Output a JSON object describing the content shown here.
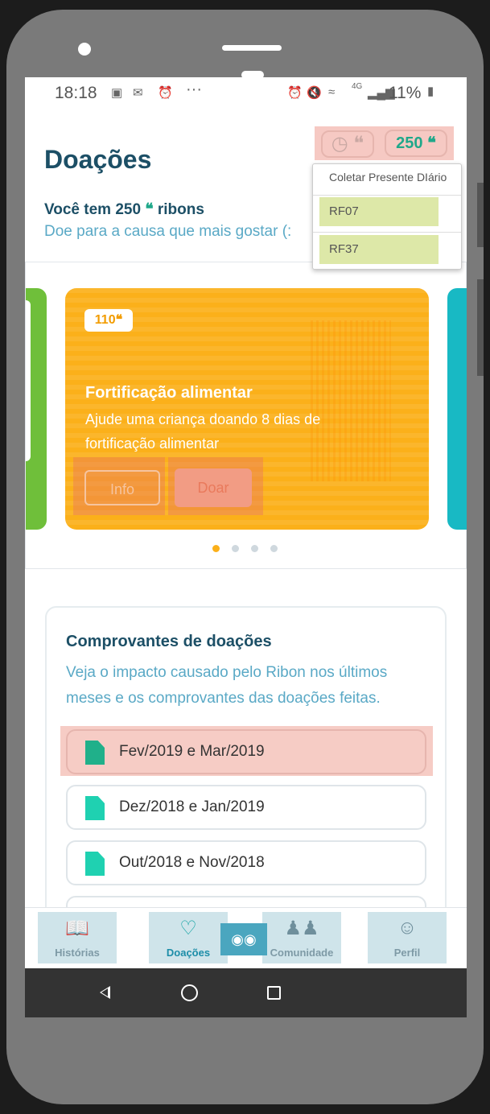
{
  "status_bar": {
    "time": "18:18",
    "dots": "···",
    "network": "4G",
    "battery": "11%"
  },
  "header": {
    "title": "Doações",
    "coins": "250",
    "history_icon": "clock-icon"
  },
  "balance": {
    "text": "Você tem 250",
    "unit": "ribons",
    "subtitle": "Doe para a causa que mais gostar (:"
  },
  "dropdown": {
    "header": "Coletar Presente DIário",
    "items": [
      "RF07",
      "RF37"
    ]
  },
  "card": {
    "price": "110",
    "title": "Fortificação alimentar",
    "description": "Ajude uma criança doando 8 dias de fortificação alimentar",
    "info_label": "Info",
    "donate_label": "Doar",
    "color": "#fbb01a"
  },
  "receipts": {
    "title": "Comprovantes de doações",
    "description": "Veja o impacto causado pelo Ribon nos últimos meses e os comprovantes das doações feitas.",
    "items": [
      "Fev/2019 e Mar/2019",
      "Dez/2018 e Jan/2019",
      "Out/2018 e Nov/2018"
    ]
  },
  "tabbar": {
    "tabs": [
      "Histórias",
      "Doações",
      "Comunidade",
      "Perfil"
    ],
    "active": "Doações"
  },
  "colors": {
    "primary_text": "#1c4f66",
    "accent": "#1fa88a",
    "card_orange": "#fbb01a"
  }
}
